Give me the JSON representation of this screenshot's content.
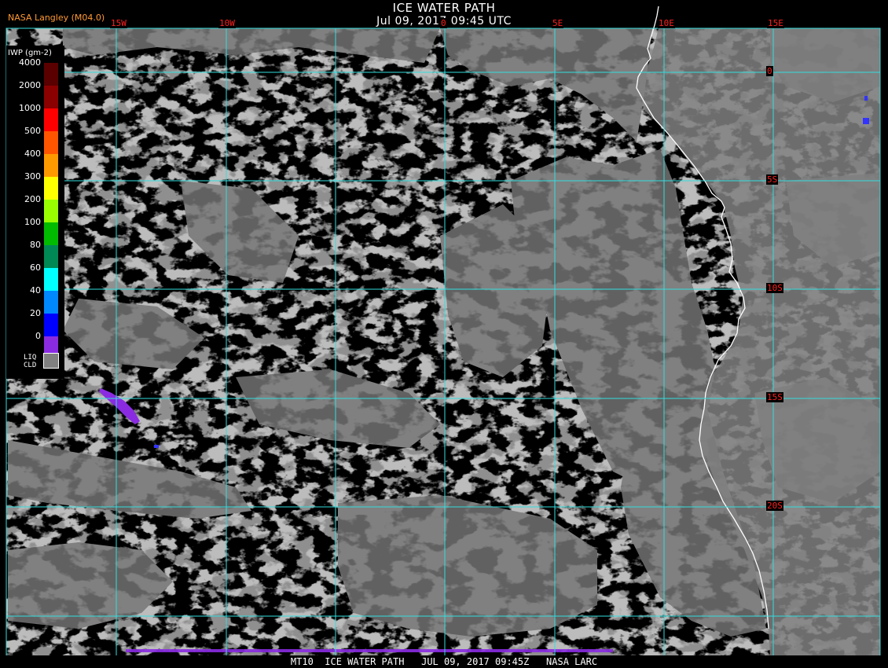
{
  "title": "ICE WATER PATH",
  "datetime": "Jul 09, 2017 09:45 UTC",
  "agency": "NASA Langley (M04.0)",
  "footer": "MT10  ICE WATER PATH   JUL 09, 2017 09:45Z   NASA LARC",
  "legend": {
    "unit": "IWP (gm-2)",
    "ticks": [
      "4000",
      "2000",
      "1000",
      "500",
      "400",
      "300",
      "200",
      "100",
      "80",
      "60",
      "40",
      "20",
      "0"
    ],
    "colors": [
      "#5a0000",
      "#8b0000",
      "#ff0000",
      "#ff5500",
      "#ff9900",
      "#ffff00",
      "#99ff00",
      "#00bb00",
      "#008855",
      "#00ffff",
      "#0088ff",
      "#0000ff",
      "#8a2be2"
    ],
    "liq_cld_label_1": "LIQ",
    "liq_cld_label_2": "CLD",
    "liq_cld_color": "#808080"
  },
  "axes": {
    "longitude_labels": [
      "15W",
      "10W",
      "0",
      "5E",
      "10E",
      "15E"
    ],
    "latitude_labels": [
      "0",
      "5S",
      "10S",
      "15S",
      "20S"
    ]
  },
  "colors": {
    "ocean": "#000000",
    "cloud": "#808080",
    "grid": "#33dddd",
    "coast": "#ffffff",
    "axis_text": "#ff2020"
  }
}
